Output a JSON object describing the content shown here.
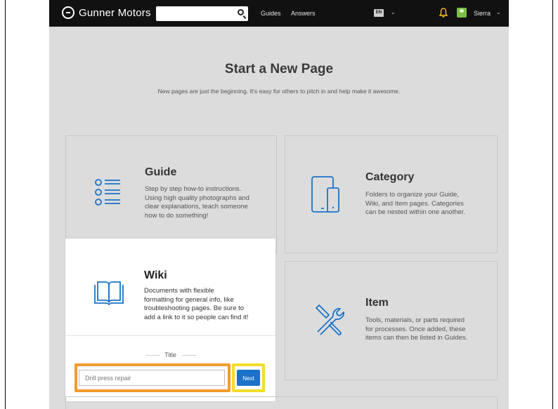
{
  "topbar": {
    "brand": "Gunner Motors",
    "search_placeholder": "",
    "nav": [
      "Guides",
      "Answers"
    ],
    "language": "EN",
    "user": "Sierra"
  },
  "page": {
    "title": "Start a New Page",
    "subtitle": "New pages are just the beginning. It's easy for others to pitch in and help make it awesome."
  },
  "cards": {
    "guide": {
      "title": "Guide",
      "desc": [
        "Step by step how-to instructions.",
        "Using high quality photographs and",
        "clear explanations, teach someone",
        "how to do something!"
      ],
      "icon": "list-icon"
    },
    "category": {
      "title": "Category",
      "desc": [
        "Folders to organize your Guide,",
        "Wiki, and Item pages. Categories",
        "can be nested within one another."
      ],
      "icon": "devices-icon"
    },
    "wiki": {
      "title": "Wiki",
      "desc": [
        "Documents with flexible",
        "formatting for general info, like",
        "troubleshooting pages. Be sure to",
        "add a link to it so people can find it!"
      ],
      "icon": "book-icon",
      "title_label": "Title",
      "input_value": "Drill press repair",
      "next_label": "Next"
    },
    "item": {
      "title": "Item",
      "desc": [
        "Tools, materials, or parts required",
        "for processes. Once added, these",
        "items can then be listed in Guides."
      ],
      "icon": "tools-icon"
    }
  },
  "colors": {
    "accent_blue": "#1a73c9",
    "highlight_orange": "#f39c2c",
    "highlight_yellow": "#f3dd2c",
    "topbar": "#111111"
  }
}
